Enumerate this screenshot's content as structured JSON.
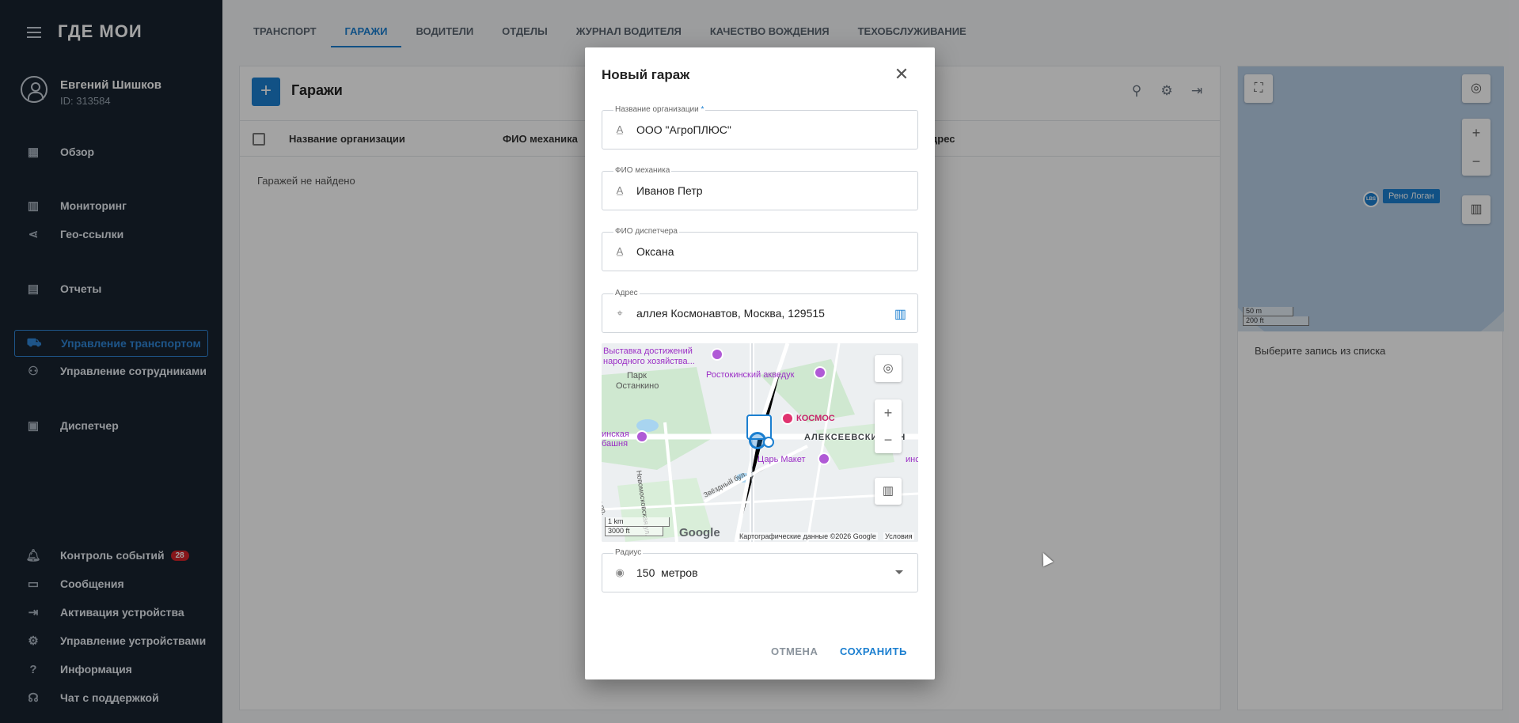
{
  "app": {
    "logo": "ГДЕ МОИ"
  },
  "user": {
    "name": "Евгений Шишков",
    "id": "ID: 313584"
  },
  "sidebar": {
    "items": [
      {
        "label": "Обзор",
        "icon": "dashboard-icon"
      },
      {
        "label": "Мониторинг",
        "icon": "map-icon"
      },
      {
        "label": "Гео-ссылки",
        "icon": "share-icon"
      },
      {
        "label": "Отчеты",
        "icon": "chart-icon"
      },
      {
        "label": "Управление транспортом",
        "icon": "car-icon"
      },
      {
        "label": "Управление сотрудниками",
        "icon": "people-icon"
      },
      {
        "label": "Диспетчер",
        "icon": "dispatcher-icon"
      },
      {
        "label": "Контроль событий",
        "icon": "bell-icon",
        "badge": "28"
      },
      {
        "label": "Сообщения",
        "icon": "message-icon"
      },
      {
        "label": "Активация устройства",
        "icon": "login-icon"
      },
      {
        "label": "Управление устройствами",
        "icon": "gear-icon"
      },
      {
        "label": "Информация",
        "icon": "help-icon"
      },
      {
        "label": "Чат с поддержкой",
        "icon": "support-icon"
      }
    ]
  },
  "tabs": [
    {
      "label": "Транспорт"
    },
    {
      "label": "Гаражи"
    },
    {
      "label": "Водители"
    },
    {
      "label": "Отделы"
    },
    {
      "label": "Журнал водителя"
    },
    {
      "label": "Качество вождения"
    },
    {
      "label": "Техобслуживание"
    }
  ],
  "main": {
    "add_label": "+",
    "title": "Гаражи",
    "columns": [
      "Название организации",
      "ФИО механика",
      "дрес"
    ],
    "empty": "Гаражей не найдено"
  },
  "right": {
    "vehicle_label": "Рено Логан",
    "vehicle_badge": "LBS",
    "scale_m": "50 m",
    "scale_ft": "200 ft",
    "hint": "Выберите запись из списка"
  },
  "dialog": {
    "title": "Новый гараж",
    "fields": {
      "org": {
        "label": "Название организации",
        "required": "*",
        "value": "ООО \"АгроПЛЮС\""
      },
      "mechanic": {
        "label": "ФИО механика",
        "value": "Иванов Петр"
      },
      "dispatcher": {
        "label": "ФИО диспетчера",
        "value": "Оксана"
      },
      "address": {
        "label": "Адрес",
        "value": "аллея Космонавтов, Москва, 129515"
      },
      "radius": {
        "label": "Радиус",
        "value": "150",
        "unit": "метров"
      }
    },
    "map": {
      "labels": {
        "vdnh1": "Выставка достижений",
        "vdnh2": "народного хозяйства...",
        "park1": "Парк",
        "park2": "Останкино",
        "aqueduct": "Ростокинский акведук",
        "kosmos": "КОСМОС",
        "tower1": "инская",
        "tower2": "башня",
        "alekseev": "АЛЕКСЕЕВСКИЙ Р-Н",
        "tsar": "Царь Макет",
        "street1": "Новомосковская ул.",
        "street2": "Звёздный бул.",
        "street3": "д пр.",
        "right_cut": "инск"
      },
      "scale_km": "1 km",
      "scale_ft": "3000 ft",
      "logo": "Google",
      "attribution": "Картографические данные ©2026 Google",
      "terms": "Условия"
    },
    "cancel": "Отмена",
    "save": "Сохранить"
  },
  "colors": {
    "accent": "#1b7fd0",
    "sidebar_bg": "#18232f",
    "badge": "#d2232a",
    "poi": "#9b2fc6"
  }
}
